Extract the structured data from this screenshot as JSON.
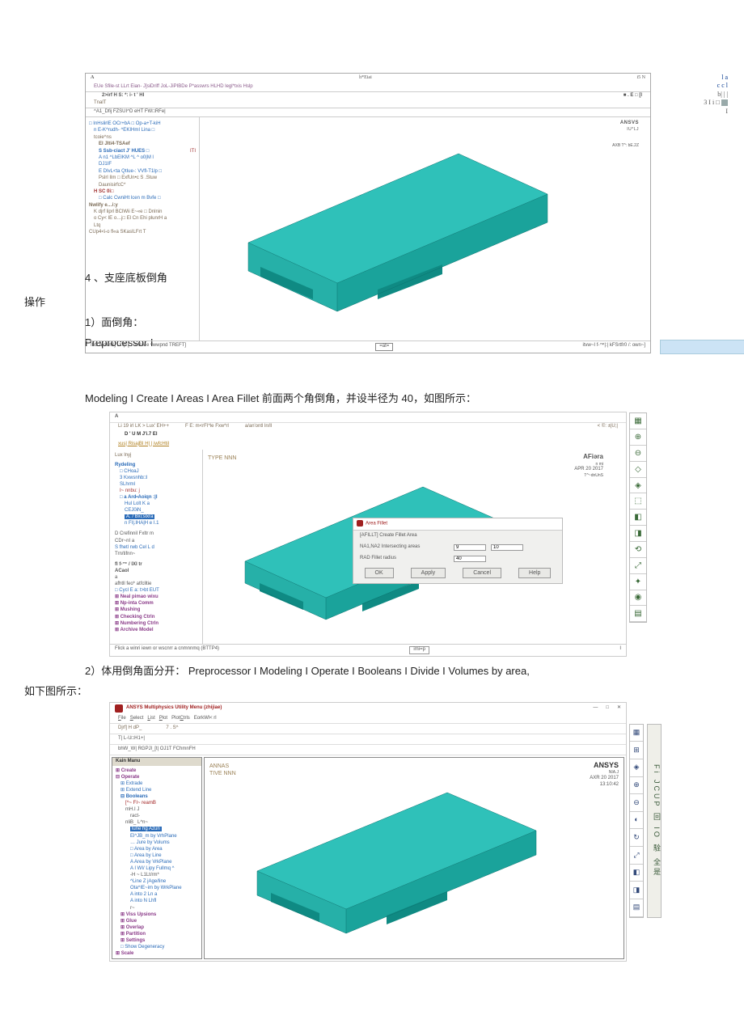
{
  "sec4_title": "4 、支座底板倒角",
  "sec4_op": "操作",
  "step1_title": "1）面倒角：",
  "step1_pre": "Preprocessor I",
  "path_line": "Modeling I Create I Areas I Area Fillet 前面两个角倒角，并设半径为  40，如图所示：",
  "step2_title": "2）体用倒角面分开：   Preprocessor I Modeling I Operate I Booleans I Divide I Volumes by area,",
  "step2_sub": "如下图所示：",
  "ss1": {
    "a": "A",
    "aright": "h*Eiai",
    "far": "i5 N",
    "r2": "EUe Sfile-st LLrt Eian- J]siDriff JoL-JiPIBDe P*asswrs HLHD legl*txis Hslp",
    "r3l": "2>irf H S:  *:  i- t ' HI",
    "r3r": "■ . E □ [l",
    "r4": "TnalT",
    "r5": "^A1_Dfij FZSUI^D eHT FW□RFe|",
    "tree": [
      {
        "c": "b",
        "t": "□ InHslirlE OCr+bA □ Op-a+T-kiH",
        "p": 0
      },
      {
        "c": "b",
        "t": "n E-K^rudh- ^EKIHmI Lina □",
        "p": 1
      },
      {
        "c": "",
        "t": "tcoie^ns",
        "p": 1
      },
      {
        "c": "bold",
        "t": "El Jlti4-TSAef",
        "p": 2
      },
      {
        "c": "r",
        "t": "ITI",
        "p": 3,
        "right": true
      },
      {
        "c": "b bold",
        "t": "S Ssb-ciact J' HUES □",
        "p": 2
      },
      {
        "c": "b",
        "t": "A n1 ^LbEIKM ^L ^ o0|M l",
        "p": 3
      },
      {
        "c": "b",
        "t": "DJ1IF",
        "p": 3
      },
      {
        "c": "b",
        "t": "E DIvL<ta QtIue-: VVfl-T1lp □",
        "p": 2
      },
      {
        "c": "",
        "t": "Pslrl Ilm □ ExfUn•c S .Stuw",
        "p": 2
      },
      {
        "c": "",
        "t": "DaunisirfcC*",
        "p": 2
      },
      {
        "c": "r bold",
        "t": "H SC 0i□",
        "p": 1
      },
      {
        "c": "b",
        "t": "□ Calc CwniHt lcen m Bvfe □",
        "p": 2
      },
      {
        "c": "bold",
        "t": "Nwlify e…i:y",
        "p": 0
      },
      {
        "c": "",
        "t": "K djrf liprl BClWii E~«e □ Dnlnin",
        "p": 1
      },
      {
        "c": "",
        "t": "o Cy< IE o…j□ El Cn Ehi plunrH a",
        "p": 1
      },
      {
        "c": "",
        "t": "Ltq",
        "p": 1
      },
      {
        "c": "",
        "t": "CUp4<i-o fl«a SKasILFrt     T",
        "p": 0
      }
    ],
    "ansys": "ANSVS",
    "ansys_sub": "IU*LJ",
    "axis": "AXB  T^: bE.2Z",
    "float_a": "l a",
    "float_b": "c   c l",
    "float_c": "b| | |",
    "float_d": "3   I i   □",
    "float_e": "I",
    "footL": "Ifldl a rwn&j Lt?p [□ on1w e ^wwpnd TREFT]",
    "footM": "=at=",
    "footR": "itvw~I f-™|:| kFSrtfr0 /: own~]"
  },
  "ss2": {
    "tb_a": "A",
    "tb2a": "Li 19 irl LK > Lux' EH++",
    "tb2b": "F  E: m<rFI*le Fxw*rl",
    "tb2c": "a/an'ontl ln/ll",
    "tb2d": "< ©:  ±|U;|",
    "tb3": "D ' U M J'i.7 El",
    "tb4": "xus| RisajBI H| | iwfcHtil",
    "lux": "Lux lnyj",
    "tree": [
      {
        "c": "b bold",
        "t": "Rydeling",
        "p": 0
      },
      {
        "c": "b",
        "t": "□ CHoaJ",
        "p": 1
      },
      {
        "c": "b",
        "t": "3 Kxwsnhb□l",
        "p": 1
      },
      {
        "c": "b",
        "t": "SLhrml",
        "p": 1
      },
      {
        "c": "r",
        "t": "I~ nnbu:  j",
        "p": 1
      },
      {
        "c": "b bold",
        "t": "□ a  Ard•Aoiqn :|I",
        "p": 1
      },
      {
        "c": "b",
        "t": " Hul Lolt K a",
        "p": 2
      },
      {
        "c": "b",
        "t": " CEJ0iN_",
        "p": 2
      },
      {
        "c": "hl",
        "t": "A. / Bxi;slxra",
        "p": 2
      },
      {
        "c": "b",
        "t": "n FI|.lHA|H e  I.1",
        "p": 2
      },
      {
        "c": "",
        "t": "",
        "p": 0
      },
      {
        "c": "",
        "t": "D Crefinnil Fxltr m",
        "p": 0
      },
      {
        "c": "",
        "t": "CDr~nI a",
        "p": 0
      },
      {
        "c": "b",
        "t": "S fhetl rwb Cel L d",
        "p": 0
      },
      {
        "c": "",
        "t": "Trn/tifnn~",
        "p": 0
      },
      {
        "c": "",
        "t": "",
        "p": 0
      },
      {
        "c": "bold",
        "t": "fl f-™ / IXI tr",
        "p": 0
      },
      {
        "c": "bold",
        "t": "ACaol",
        "p": 0
      },
      {
        "c": "",
        "t": "a",
        "p": 0
      },
      {
        "c": "",
        "t": "afhtll feo* atfclltie",
        "p": 0
      },
      {
        "c": "b",
        "t": "□ Cycl E a: t>bt EUT",
        "p": 0
      },
      {
        "c": "p bold",
        "t": "⊞ Neal  pimao  wixu",
        "p": 0
      },
      {
        "c": "p bold",
        "t": "⊞ Np-inta  Comm",
        "p": 0
      },
      {
        "c": "p bold",
        "t": "⊞ Mushing",
        "p": 0
      },
      {
        "c": "p bold",
        "t": "⊞ Checking  Ctrln",
        "p": 0
      },
      {
        "c": "p bold",
        "t": "⊞ Numbering  Ctrln",
        "p": 0
      },
      {
        "c": "p bold",
        "t": "⊞ Archive  Model",
        "p": 0
      }
    ],
    "tag_l": "TYPE  NNN",
    "al_t": "AFiəra",
    "al_s": "n mi",
    "al_d": "APR  20  2017",
    "al_t2": "T^~dnUnS",
    "dlg_title": "Area Fillet",
    "dlg_l1": "[AFILLT]  Create Fillet Area",
    "dlg_l2": "NA1,NA2  Intersecting areas",
    "dlg_l3": "RAD      Fillet radius",
    "dlg_in1": "9",
    "dlg_in2": "10",
    "dlg_in3": "40",
    "dlg_ok": "OK",
    "dlg_ap": "Apply",
    "dlg_ca": "Cancel",
    "dlg_he": "Help",
    "footL": "Flick a winri iewn or wscnrr a cnmnnmq  (BTTP4)",
    "footM": "imi=p",
    "footR": "I"
  },
  "ss3": {
    "title": "ANSYS Multiphysics Utility Menu (zhijiae)",
    "menus": "File   Select   List   Plot   PlotCtrls   EorkWl< rl",
    "bar1a": "Djrf] H dP_",
    "bar1b": "7 . S^",
    "bar2": "T| L-U□H1+|",
    "bar3": "bhW_W| RGPJl_[t| OJ1T FChmnFH",
    "side_hd": "Kain Manu",
    "tree": [
      {
        "c": "p bold",
        "t": "⊞ Create",
        "p": 0
      },
      {
        "c": "p bold",
        "t": "⊟ Operate",
        "p": 0
      },
      {
        "c": "b",
        "t": "⊞ Extrade",
        "p": 1
      },
      {
        "c": "b",
        "t": "⊞ Extend Line",
        "p": 1
      },
      {
        "c": "b bold",
        "t": "⊟ Booleans",
        "p": 1
      },
      {
        "c": "r",
        "t": "[^~ FI~  reamB",
        "p": 2
      },
      {
        "c": "",
        "t": "mH.I J",
        "p": 2
      },
      {
        "c": "",
        "t": "ract-",
        "p": 3
      },
      {
        "c": "",
        "t": "nliB_   L^n~",
        "p": 2
      },
      {
        "c": "hl",
        "t": "lune  hg  Azun",
        "p": 3
      },
      {
        "c": "b",
        "t": "El^JB_m  by  VrhPlane",
        "p": 3
      },
      {
        "c": "b",
        "t": "… Jure  by  Volums",
        "p": 3
      },
      {
        "c": "b",
        "t": "□ Area  by  Area",
        "p": 3
      },
      {
        "c": "b",
        "t": "□ Area  by  Line",
        "p": 3
      },
      {
        "c": "b",
        "t": "A Area  by  VrkPlane",
        "p": 3
      },
      {
        "c": "b",
        "t": "A  I WI/  Lipy  Fullmq ^",
        "p": 3
      },
      {
        "c": "",
        "t": "-H ~ L1Lt/rm*",
        "p": 3
      },
      {
        "c": "b",
        "t": "^Line  Z jAge/line",
        "p": 3
      },
      {
        "c": "b",
        "t": "Ota^IE~im  by  WrkPlane",
        "p": 3
      },
      {
        "c": "b",
        "t": "A  into  2  Ln a",
        "p": 3
      },
      {
        "c": "b",
        "t": "A  into  N  Lhfl",
        "p": 3
      },
      {
        "c": "",
        "t": "r~",
        "p": 3
      },
      {
        "c": "p bold",
        "t": "⊞ Viss  Upsions",
        "p": 1
      },
      {
        "c": "p bold",
        "t": "⊞ Glue",
        "p": 1
      },
      {
        "c": "p bold",
        "t": "⊞ Overlap",
        "p": 1
      },
      {
        "c": "p bold",
        "t": "⊞ Partition",
        "p": 1
      },
      {
        "c": "p bold",
        "t": "⊞ Settings",
        "p": 1
      },
      {
        "c": "b",
        "t": "□ Show Degeneracy",
        "p": 1
      },
      {
        "c": "p bold",
        "t": "⊞ Scale",
        "p": 0
      }
    ],
    "tag_l": "TIVE  NNN",
    "tag_pre": "ANNAS",
    "al_t": "ANSYS",
    "al_s": "NIA.J",
    "al_d": "AXR  20  2017",
    "al_t2": "13:10:42",
    "rt2": "Fi JCUP 回 IO 駩 全是"
  }
}
